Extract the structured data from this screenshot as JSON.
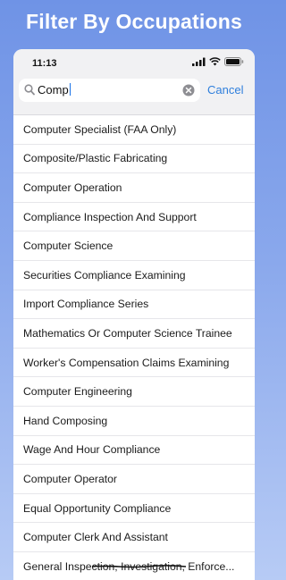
{
  "promo": {
    "title": "Filter By Occupations"
  },
  "status_bar": {
    "time": "11:13"
  },
  "search": {
    "value": "Comp",
    "cancel_label": "Cancel"
  },
  "results": [
    "Computer Specialist (FAA Only)",
    "Composite/Plastic Fabricating",
    "Computer Operation",
    "Compliance Inspection And Support",
    "Computer Science",
    "Securities Compliance Examining",
    "Import Compliance Series",
    "Mathematics Or Computer Science Trainee",
    "Worker's Compensation Claims Examining",
    "Computer Engineering",
    "Hand Composing",
    "Wage And Hour Compliance",
    "Computer Operator",
    "Equal Opportunity Compliance",
    "Computer Clerk And Assistant",
    "General Inspection, Investigation, Enforce..."
  ],
  "colors": {
    "accent": "#2f7fdc",
    "background_top": "#6f93e6",
    "background_bottom": "#b7cbf5"
  },
  "icons": [
    "signal-icon",
    "wifi-icon",
    "battery-icon",
    "search-icon",
    "clear-icon"
  ]
}
